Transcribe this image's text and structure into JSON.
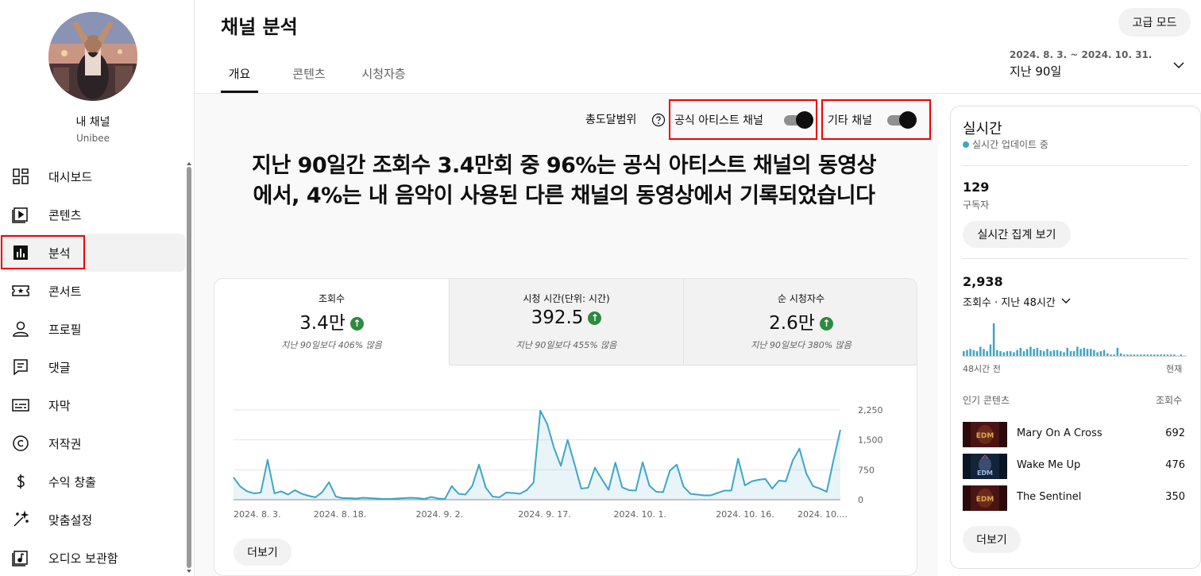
{
  "sidebar": {
    "channel_name": "내 채널",
    "channel_handle": "Unibee",
    "items": [
      {
        "label": "대시보드",
        "icon": "dashboard-icon"
      },
      {
        "label": "콘텐츠",
        "icon": "content-icon"
      },
      {
        "label": "분석",
        "icon": "analytics-icon",
        "active": true
      },
      {
        "label": "콘서트",
        "icon": "ticket-icon"
      },
      {
        "label": "프로필",
        "icon": "profile-icon"
      },
      {
        "label": "댓글",
        "icon": "comments-icon"
      },
      {
        "label": "자막",
        "icon": "subtitles-icon"
      },
      {
        "label": "저작권",
        "icon": "copyright-icon"
      },
      {
        "label": "수익 창출",
        "icon": "dollar-icon"
      },
      {
        "label": "맞춤설정",
        "icon": "magic-wand-icon"
      },
      {
        "label": "오디오 보관함",
        "icon": "audio-library-icon"
      }
    ]
  },
  "header": {
    "title": "채널 분석",
    "advanced_mode": "고급 모드",
    "tabs": [
      {
        "label": "개요",
        "active": true
      },
      {
        "label": "콘텐츠"
      },
      {
        "label": "시청자층"
      }
    ],
    "date_range": "2024. 8. 3. ~ 2024. 10. 31.",
    "date_label": "지난 90일"
  },
  "reach": {
    "label": "총도달범위",
    "toggle_official": "공식 아티스트 채널",
    "toggle_other": "기타 채널",
    "official_on": true,
    "other_on": true
  },
  "headline": "지난 90일간 조회수 3.4만회 중 96%는 공식 아티스트 채널의 동영상에서, 4%는 내 음악이 사용된 다른 채널의 동영상에서 기록되었습니다",
  "metrics": [
    {
      "label": "조회수",
      "value": "3.4만",
      "delta": "지난 90일보다 406% 많음"
    },
    {
      "label": "시청 시간(단위: 시간)",
      "value": "392.5",
      "delta": "지난 90일보다 455% 많음"
    },
    {
      "label": "순 시청자수",
      "value": "2.6만",
      "delta": "지난 90일보다 380% 많음"
    }
  ],
  "more_button": "더보기",
  "chart_data": {
    "type": "area",
    "title": "",
    "xlabel": "",
    "ylabel": "",
    "ylim": [
      0,
      2250
    ],
    "yticks": [
      "2,250",
      "1,500",
      "750",
      "0"
    ],
    "xticks": [
      "2024. 8. 3.",
      "2024. 8. 18.",
      "2024. 9. 2.",
      "2024. 9. 17.",
      "2024. 10. 1.",
      "2024. 10. 16.",
      "2024. 10...."
    ],
    "x": [
      "2024-08-03",
      "2024-08-04",
      "2024-08-05",
      "2024-08-06",
      "2024-08-07",
      "2024-08-08",
      "2024-08-09",
      "2024-08-10",
      "2024-08-11",
      "2024-08-12",
      "2024-08-13",
      "2024-08-14",
      "2024-08-15",
      "2024-08-16",
      "2024-08-17",
      "2024-08-18",
      "2024-08-19",
      "2024-08-20",
      "2024-08-21",
      "2024-08-22",
      "2024-08-23",
      "2024-08-24",
      "2024-08-25",
      "2024-08-26",
      "2024-08-27",
      "2024-08-28",
      "2024-08-29",
      "2024-08-30",
      "2024-08-31",
      "2024-09-01",
      "2024-09-02",
      "2024-09-03",
      "2024-09-04",
      "2024-09-05",
      "2024-09-06",
      "2024-09-07",
      "2024-09-08",
      "2024-09-09",
      "2024-09-10",
      "2024-09-11",
      "2024-09-12",
      "2024-09-13",
      "2024-09-14",
      "2024-09-15",
      "2024-09-16",
      "2024-09-17",
      "2024-09-18",
      "2024-09-19",
      "2024-09-20",
      "2024-09-21",
      "2024-09-22",
      "2024-09-23",
      "2024-09-24",
      "2024-09-25",
      "2024-09-26",
      "2024-09-27",
      "2024-09-28",
      "2024-09-29",
      "2024-09-30",
      "2024-10-01",
      "2024-10-02",
      "2024-10-03",
      "2024-10-04",
      "2024-10-05",
      "2024-10-06",
      "2024-10-07",
      "2024-10-08",
      "2024-10-09",
      "2024-10-10",
      "2024-10-11",
      "2024-10-12",
      "2024-10-13",
      "2024-10-14",
      "2024-10-15",
      "2024-10-16",
      "2024-10-17",
      "2024-10-18",
      "2024-10-19",
      "2024-10-20",
      "2024-10-21",
      "2024-10-22",
      "2024-10-23",
      "2024-10-24",
      "2024-10-25",
      "2024-10-26",
      "2024-10-27",
      "2024-10-28",
      "2024-10-29",
      "2024-10-30",
      "2024-10-31"
    ],
    "series": [
      {
        "values": [
          560,
          330,
          210,
          160,
          180,
          1000,
          160,
          210,
          130,
          240,
          150,
          100,
          60,
          190,
          440,
          80,
          40,
          40,
          30,
          50,
          40,
          30,
          20,
          20,
          30,
          40,
          50,
          40,
          20,
          70,
          30,
          20,
          340,
          150,
          130,
          340,
          880,
          300,
          80,
          60,
          180,
          170,
          150,
          240,
          430,
          2230,
          1900,
          1300,
          850,
          1500,
          900,
          280,
          300,
          800,
          520,
          250,
          930,
          310,
          240,
          230,
          940,
          350,
          200,
          190,
          730,
          880,
          330,
          150,
          130,
          110,
          110,
          170,
          230,
          230,
          1030,
          360,
          460,
          500,
          520,
          280,
          480,
          460,
          980,
          1280,
          660,
          340,
          280,
          200,
          1000,
          1750
        ]
      }
    ]
  },
  "realtime": {
    "title": "실시간",
    "live_label": "실시간 업데이트 중",
    "subscribers": "129",
    "subscribers_label": "구독자",
    "aggregate_button": "실시간 집계 보기",
    "views": "2,938",
    "views_label": "조회수 · 지난 48시간",
    "axis_left": "48시간 전",
    "axis_right": "현재",
    "top_content_label": "인기 콘텐츠",
    "top_views_label": "조회수",
    "spark_values": [
      10,
      12,
      14,
      12,
      10,
      18,
      14,
      10,
      22,
      60,
      12,
      10,
      8,
      10,
      10,
      8,
      12,
      16,
      10,
      14,
      18,
      14,
      16,
      12,
      10,
      14,
      10,
      12,
      12,
      10,
      8,
      16,
      10,
      10,
      18,
      14,
      16,
      14,
      14,
      12,
      8,
      10,
      12,
      6,
      4,
      4,
      16,
      6,
      4,
      4,
      4,
      4,
      4,
      4,
      4,
      4,
      4,
      4,
      4,
      4,
      4,
      4,
      4,
      4,
      2,
      4,
      2
    ],
    "top_content": [
      {
        "title": "Mary On A Cross",
        "views": "692"
      },
      {
        "title": "Wake Me Up",
        "views": "476"
      },
      {
        "title": "The Sentinel",
        "views": "350"
      }
    ],
    "more_button": "더보기",
    "live_color": "#3ea6c6"
  },
  "colors": {
    "accent_chart": "#3ea6c6",
    "positive": "#2d8a3e",
    "highlight": "#e00000"
  }
}
